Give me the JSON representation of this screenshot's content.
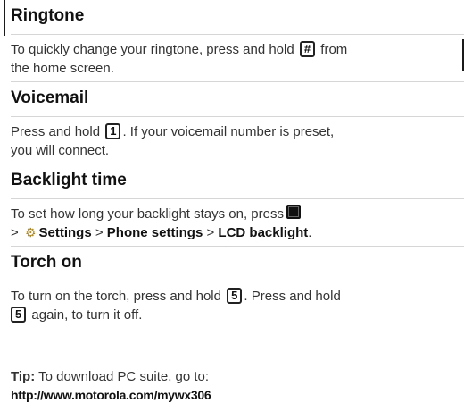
{
  "ringtone": {
    "title": "Ringtone",
    "text_before_key": "To quickly change your ringtone, press and hold ",
    "key": "#",
    "text_after_key": " from",
    "line2": "the home screen."
  },
  "voicemail": {
    "title": "Voicemail",
    "text_before_key": "Press and hold ",
    "key": "1",
    "text_after_key": ". If your voicemail number is preset,",
    "line2": "you will connect."
  },
  "backlight": {
    "title": "Backlight time",
    "line1": "To set how long your backlight stays on, press",
    "sep1": ">",
    "settings": "Settings",
    "sep2": ">",
    "phone_settings": "Phone settings",
    "sep3": ">",
    "lcd_backlight": "LCD backlight",
    "end": "."
  },
  "torch": {
    "title": "Torch on",
    "text_before_key": "To turn on the torch, press and hold ",
    "key": "5",
    "text_after_key": ". Press and hold",
    "key2": "5",
    "line2_after": " again, to turn it off."
  },
  "tip": {
    "label": "Tip:",
    "text": " To download PC suite, go to:",
    "url": "http://www.motorola.com/mywx306"
  }
}
